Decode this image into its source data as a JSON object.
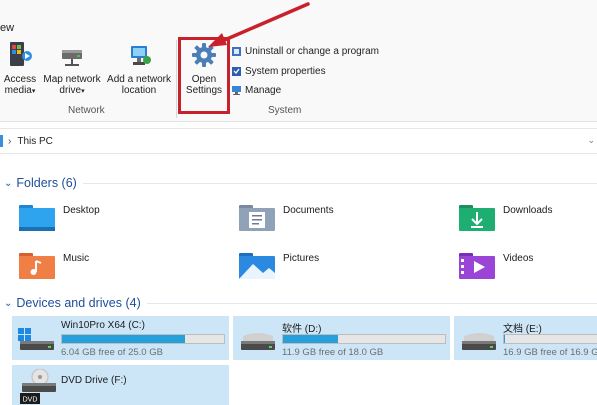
{
  "ribbon": {
    "tab_label": "ew",
    "network_buttons": [
      {
        "label_line1": "Access",
        "label_line2": "media",
        "has_caret": true,
        "icon": "access-media-icon"
      },
      {
        "label_line1": "Map network",
        "label_line2": "drive",
        "has_caret": true,
        "icon": "map-network-drive-icon"
      },
      {
        "label_line1": "Add a network",
        "label_line2": "location",
        "has_caret": false,
        "icon": "add-network-location-icon"
      }
    ],
    "network_group_label": "Network",
    "settings_button": {
      "label_line1": "Open",
      "label_line2": "Settings",
      "icon": "gear-icon"
    },
    "system_items": [
      {
        "label": "Uninstall or change a program",
        "icon": "uninstall-icon"
      },
      {
        "label": "System properties",
        "icon": "system-properties-icon"
      },
      {
        "label": "Manage",
        "icon": "manage-icon"
      }
    ],
    "system_group_label": "System",
    "caret": "▾"
  },
  "address_bar": {
    "chevron": "›",
    "path": "This PC",
    "dropdown": "⌄"
  },
  "folders_section": {
    "title": "Folders (6)",
    "chevron": "⌄",
    "items": [
      {
        "name": "Desktop",
        "icon": "desktop-folder-icon"
      },
      {
        "name": "Documents",
        "icon": "documents-folder-icon"
      },
      {
        "name": "Downloads",
        "icon": "downloads-folder-icon"
      },
      {
        "name": "Music",
        "icon": "music-folder-icon"
      },
      {
        "name": "Pictures",
        "icon": "pictures-folder-icon"
      },
      {
        "name": "Videos",
        "icon": "videos-folder-icon"
      }
    ]
  },
  "drives_section": {
    "title": "Devices and drives (4)",
    "chevron": "⌄",
    "drives": [
      {
        "name": "Win10Pro X64 (C:)",
        "free": "6.04 GB free of 25.0 GB",
        "used_fraction": 0.76,
        "icon": "windows-drive-icon"
      },
      {
        "name": "软件 (D:)",
        "free": "11.9 GB free of 18.0 GB",
        "used_fraction": 0.34,
        "icon": "hard-drive-icon"
      },
      {
        "name": "文档 (E:)",
        "free": "16.9 GB free of 16.9 G",
        "used_fraction": 0.01,
        "icon": "hard-drive-icon"
      },
      {
        "name": "DVD Drive (F:)",
        "dvd_label": "DVD",
        "icon": "dvd-drive-icon"
      }
    ]
  },
  "colors": {
    "highlight_box": "#c9212b",
    "drive_selected_bg": "#cde6f7",
    "usage_bar": "#26a0da",
    "section_title": "#1e4e9a"
  }
}
